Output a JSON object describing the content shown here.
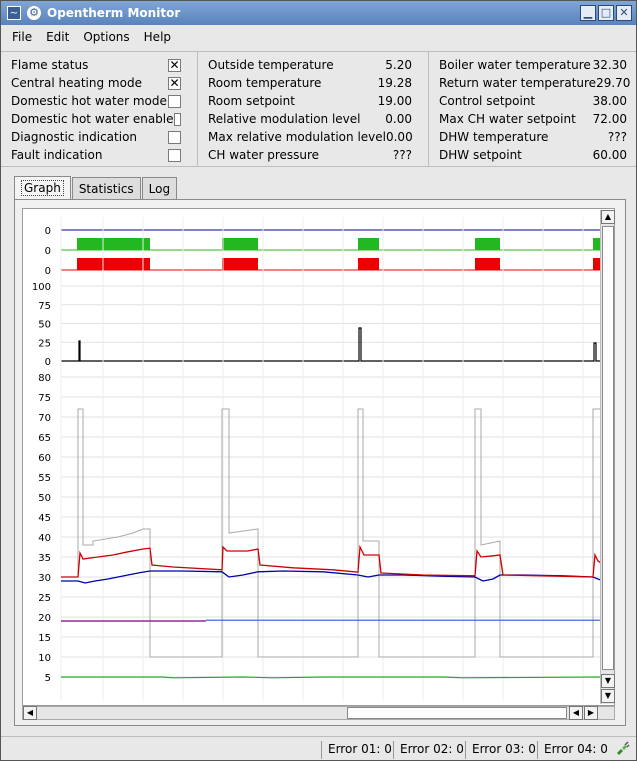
{
  "window": {
    "title": "Opentherm Monitor",
    "minimize": "▁",
    "maximize": "□",
    "close": "✕"
  },
  "menu": [
    "File",
    "Edit",
    "Options",
    "Help"
  ],
  "status_flags": [
    {
      "label": "Flame status",
      "checked": true
    },
    {
      "label": "Central heating mode",
      "checked": true
    },
    {
      "label": "Domestic hot water mode",
      "checked": false
    },
    {
      "label": "Domestic hot water enable",
      "checked": false
    },
    {
      "label": "Diagnostic indication",
      "checked": false
    },
    {
      "label": "Fault indication",
      "checked": false
    }
  ],
  "readings_mid": [
    {
      "label": "Outside temperature",
      "value": "5.20"
    },
    {
      "label": "Room temperature",
      "value": "19.28"
    },
    {
      "label": "Room setpoint",
      "value": "19.00"
    },
    {
      "label": "Relative modulation level",
      "value": "0.00"
    },
    {
      "label": "Max relative modulation level",
      "value": "0.00"
    },
    {
      "label": "CH water pressure",
      "value": "???"
    }
  ],
  "readings_right": [
    {
      "label": "Boiler water temperature",
      "value": "32.30"
    },
    {
      "label": "Return water temperature",
      "value": "29.70"
    },
    {
      "label": "Control setpoint",
      "value": "38.00"
    },
    {
      "label": "Max CH water setpoint",
      "value": "72.00"
    },
    {
      "label": "DHW temperature",
      "value": "???"
    },
    {
      "label": "DHW setpoint",
      "value": "60.00"
    }
  ],
  "tabs": [
    {
      "label": "Graph",
      "active": true
    },
    {
      "label": "Statistics",
      "active": false
    },
    {
      "label": "Log",
      "active": false
    }
  ],
  "graph": {
    "flag_rows": [
      {
        "label": "0",
        "color": "#00008b"
      },
      {
        "label": "0",
        "color": "#22b822"
      },
      {
        "label": "0",
        "color": "#ee0000"
      }
    ],
    "modulation_ticks": [
      "100",
      "75",
      "50",
      "25",
      "0"
    ],
    "temp_ticks": [
      "80",
      "75",
      "70",
      "65",
      "60",
      "55",
      "50",
      "45",
      "40",
      "35",
      "30",
      "25",
      "20",
      "15",
      "10",
      "5"
    ],
    "colors": {
      "boiler": "#cc0000",
      "return": "#0000aa",
      "control_setpoint": "#aaaaaa",
      "room_setpoint": "#800080",
      "room_temperature": "#2060d0",
      "outside": "#22aa22",
      "modulation": "#000000",
      "grid": "#e2e2e2"
    }
  },
  "statusbar": {
    "errors": [
      {
        "label": "Error 01:",
        "value": "0"
      },
      {
        "label": "Error 02:",
        "value": "0"
      },
      {
        "label": "Error 03:",
        "value": "0"
      },
      {
        "label": "Error 04:",
        "value": "0"
      }
    ]
  }
}
